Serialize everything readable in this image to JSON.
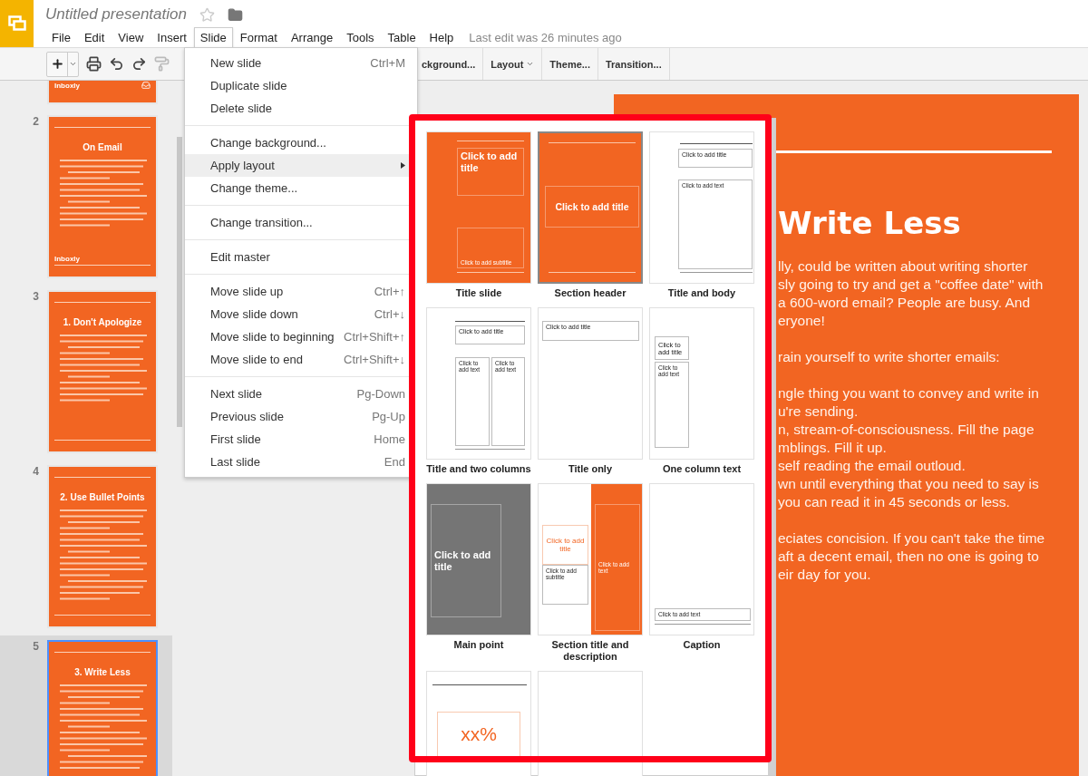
{
  "app": {
    "title": "Untitled presentation",
    "last_edit": "Last edit was 26 minutes ago"
  },
  "menus": [
    {
      "label": "File",
      "selected": false
    },
    {
      "label": "Edit",
      "selected": false
    },
    {
      "label": "View",
      "selected": false
    },
    {
      "label": "Insert",
      "selected": false
    },
    {
      "label": "Slide",
      "selected": true
    },
    {
      "label": "Format",
      "selected": false
    },
    {
      "label": "Arrange",
      "selected": false
    },
    {
      "label": "Tools",
      "selected": false
    },
    {
      "label": "Table",
      "selected": false
    },
    {
      "label": "Help",
      "selected": false
    }
  ],
  "toolbar": {
    "buttons": [
      {
        "label": "ckground...",
        "dropdown": false
      },
      {
        "label": "Layout",
        "dropdown": true
      },
      {
        "label": "Theme...",
        "dropdown": false
      },
      {
        "label": "Transition...",
        "dropdown": false
      }
    ]
  },
  "slides": [
    {
      "kind": "cut",
      "footer": "Inboxly",
      "selected": false
    },
    {
      "kind": "full",
      "number": "2",
      "title": "On Email",
      "footer": "Inboxly",
      "selected": false
    },
    {
      "kind": "full",
      "number": "3",
      "title": "1. Don't Apologize",
      "selected": false
    },
    {
      "kind": "full",
      "number": "4",
      "title": "2. Use Bullet Points",
      "selected": false
    },
    {
      "kind": "full",
      "number": "5",
      "title": "3. Write Less",
      "selected": true
    }
  ],
  "slide_menu": {
    "groups": [
      [
        {
          "label": "New slide",
          "shortcut": "Ctrl+M",
          "highlighted": false,
          "submenu": false
        },
        {
          "label": "Duplicate slide",
          "highlighted": false,
          "submenu": false
        },
        {
          "label": "Delete slide",
          "highlighted": false,
          "submenu": false
        }
      ],
      [
        {
          "label": "Change background...",
          "highlighted": false,
          "submenu": false
        },
        {
          "label": "Apply layout",
          "highlighted": true,
          "submenu": true
        },
        {
          "label": "Change theme...",
          "highlighted": false,
          "submenu": false
        }
      ],
      [
        {
          "label": "Change transition...",
          "highlighted": false,
          "submenu": false
        }
      ],
      [
        {
          "label": "Edit master",
          "highlighted": false,
          "submenu": false
        }
      ],
      [
        {
          "label": "Move slide up",
          "shortcut": "Ctrl+↑",
          "highlighted": false,
          "submenu": false
        },
        {
          "label": "Move slide down",
          "shortcut": "Ctrl+↓",
          "highlighted": false,
          "submenu": false
        },
        {
          "label": "Move slide to beginning",
          "shortcut": "Ctrl+Shift+↑",
          "highlighted": false,
          "submenu": false
        },
        {
          "label": "Move slide to end",
          "shortcut": "Ctrl+Shift+↓",
          "highlighted": false,
          "submenu": false
        }
      ],
      [
        {
          "label": "Next slide",
          "shortcut": "Pg-Down",
          "highlighted": false,
          "submenu": false
        },
        {
          "label": "Previous slide",
          "shortcut": "Pg-Up",
          "highlighted": false,
          "submenu": false
        },
        {
          "label": "First slide",
          "shortcut": "Home",
          "highlighted": false,
          "submenu": false
        },
        {
          "label": "Last slide",
          "shortcut": "End",
          "highlighted": false,
          "submenu": false
        }
      ]
    ]
  },
  "layouts": [
    {
      "name": "Title slide",
      "kind": "title",
      "selected": false,
      "title": "Click to add title",
      "body": "Click to add subtitle"
    },
    {
      "name": "Section header",
      "kind": "section",
      "selected": true,
      "title": "Click to add title"
    },
    {
      "name": "Title and body",
      "kind": "title_body",
      "selected": false,
      "title": "Click to add title",
      "body": "Click to add text"
    },
    {
      "name": "Title and two columns",
      "kind": "two_columns",
      "selected": false,
      "title": "Click to add title",
      "body": "Click to add text",
      "body_2": "Click to add text"
    },
    {
      "name": "Title only",
      "kind": "title_only",
      "selected": false,
      "title": "Click to add title"
    },
    {
      "name": "One column text",
      "kind": "one_column",
      "selected": false,
      "title": "Click to add title",
      "body": "Click to add text"
    },
    {
      "name": "Main point",
      "kind": "main_point",
      "selected": false,
      "title": "Click to add title"
    },
    {
      "name": "Section title and description",
      "kind": "section_description",
      "selected": false,
      "title": "Click to add title",
      "body": "Click to add subtitle",
      "body_2": "Click to add text"
    },
    {
      "name": "Caption",
      "kind": "caption",
      "selected": false,
      "body": "Click to add text"
    },
    {
      "kind": "big_number",
      "selected": false,
      "title": "xx%"
    },
    {
      "kind": "blank",
      "selected": false
    }
  ],
  "current_slide": {
    "title": "Write Less",
    "paragraphs": [
      [
        "lly, could be written about writing shorter",
        "sly going to try and get a \"coffee date\" with",
        "a 600-word email? People are busy. And",
        "eryone!"
      ],
      [
        "rain yourself to write shorter emails:"
      ],
      [
        "ngle thing you want to convey and write in",
        "u're sending.",
        "n, stream-of-consciousness. Fill the page",
        "mblings. Fill it up.",
        "self reading the email outloud.",
        "wn until everything that you need to say is",
        "you can read it in 45 seconds or less."
      ],
      [
        "eciates concision. If you can't take the time",
        "aft a decent email, then no one is going to",
        "eir day for you."
      ]
    ]
  }
}
